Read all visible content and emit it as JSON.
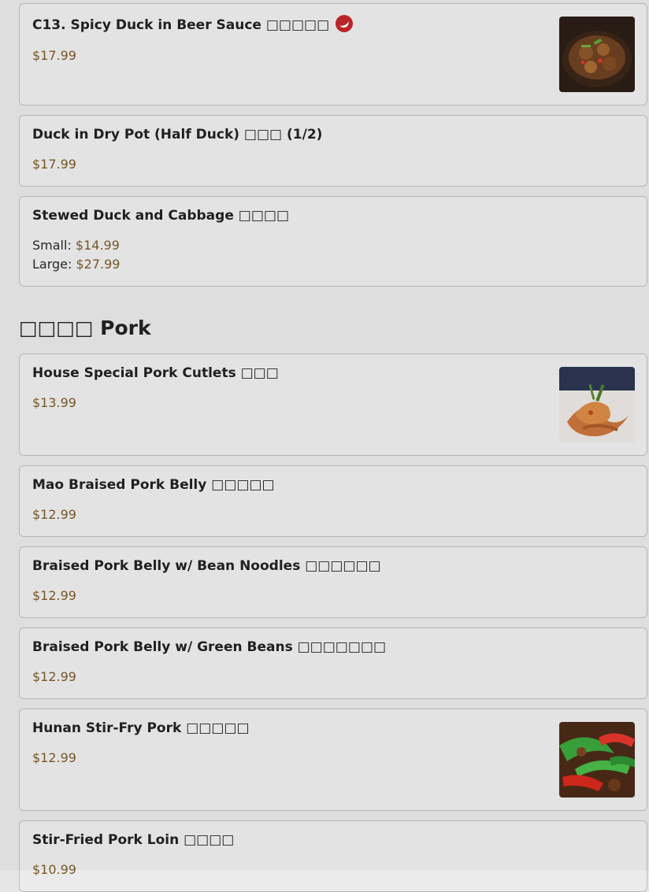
{
  "items": [
    {
      "name": "C13. Spicy Duck in Beer Sauce □□□□□",
      "price": "$17.99",
      "spicy": true,
      "thumb": "duck-dish-photo"
    },
    {
      "name": "Duck in Dry Pot (Half Duck) □□□ (1/2)",
      "price": "$17.99"
    },
    {
      "name": "Stewed Duck and Cabbage □□□□",
      "sizes": [
        {
          "label": "Small:",
          "price": "$14.99"
        },
        {
          "label": "Large:",
          "price": "$27.99"
        }
      ]
    },
    {
      "name": "House Special Pork Cutlets □□□",
      "price": "$13.99",
      "thumb": "pork-cutlets-photo"
    },
    {
      "name": "Mao Braised Pork Belly □□□□□",
      "price": "$12.99"
    },
    {
      "name": "Braised Pork Belly w/ Bean Noodles □□□□□□",
      "price": "$12.99"
    },
    {
      "name": "Braised Pork Belly w/ Green Beans □□□□□□□",
      "price": "$12.99"
    },
    {
      "name": "Hunan Stir-Fry Pork □□□□□",
      "price": "$12.99",
      "thumb": "stir-fry-pork-photo"
    },
    {
      "name": "Stir-Fried Pork Loin □□□□",
      "price": "$10.99"
    }
  ],
  "section": {
    "title": "□□□□ Pork"
  },
  "icons": {
    "spicy": "chili-pepper-icon"
  },
  "colors": {
    "price": "#7a5a2a",
    "spicy_badge": "#c2262b"
  }
}
